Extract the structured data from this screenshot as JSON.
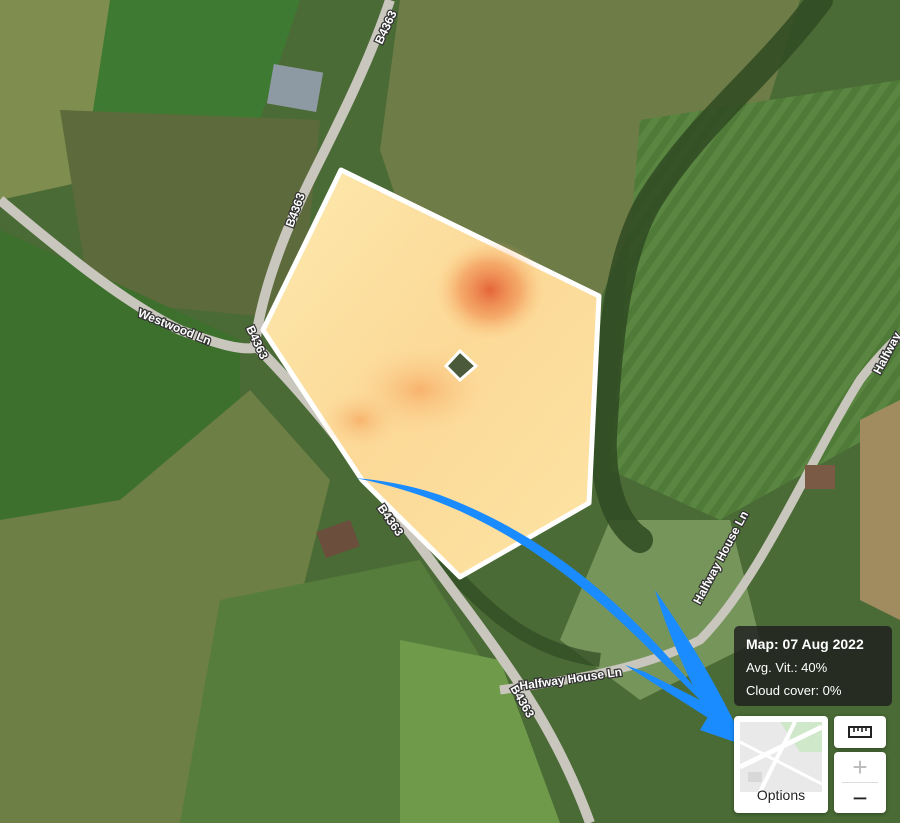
{
  "roads": {
    "b4363_labels": [
      "B4363",
      "B4363",
      "B4363",
      "B4363",
      "B4363"
    ],
    "westwood": "Westwood Ln",
    "halfway_1": "Halfway House Ln",
    "halfway_2": "Halfway House Ln",
    "halfway_3": "Halfway"
  },
  "info": {
    "map_date": "Map: 07 Aug 2022",
    "avg_vitality": "Avg. Vit.: 40%",
    "cloud_cover": "Cloud cover: 0%"
  },
  "controls": {
    "options_label": "Options",
    "ruler_icon": "ruler-icon",
    "zoom_in": "+",
    "zoom_out": "−"
  },
  "colors": {
    "arrow": "#1a8cff",
    "field_light": "#fde7a8",
    "field_hot": "#e8663a",
    "boundary": "#ffffff"
  }
}
